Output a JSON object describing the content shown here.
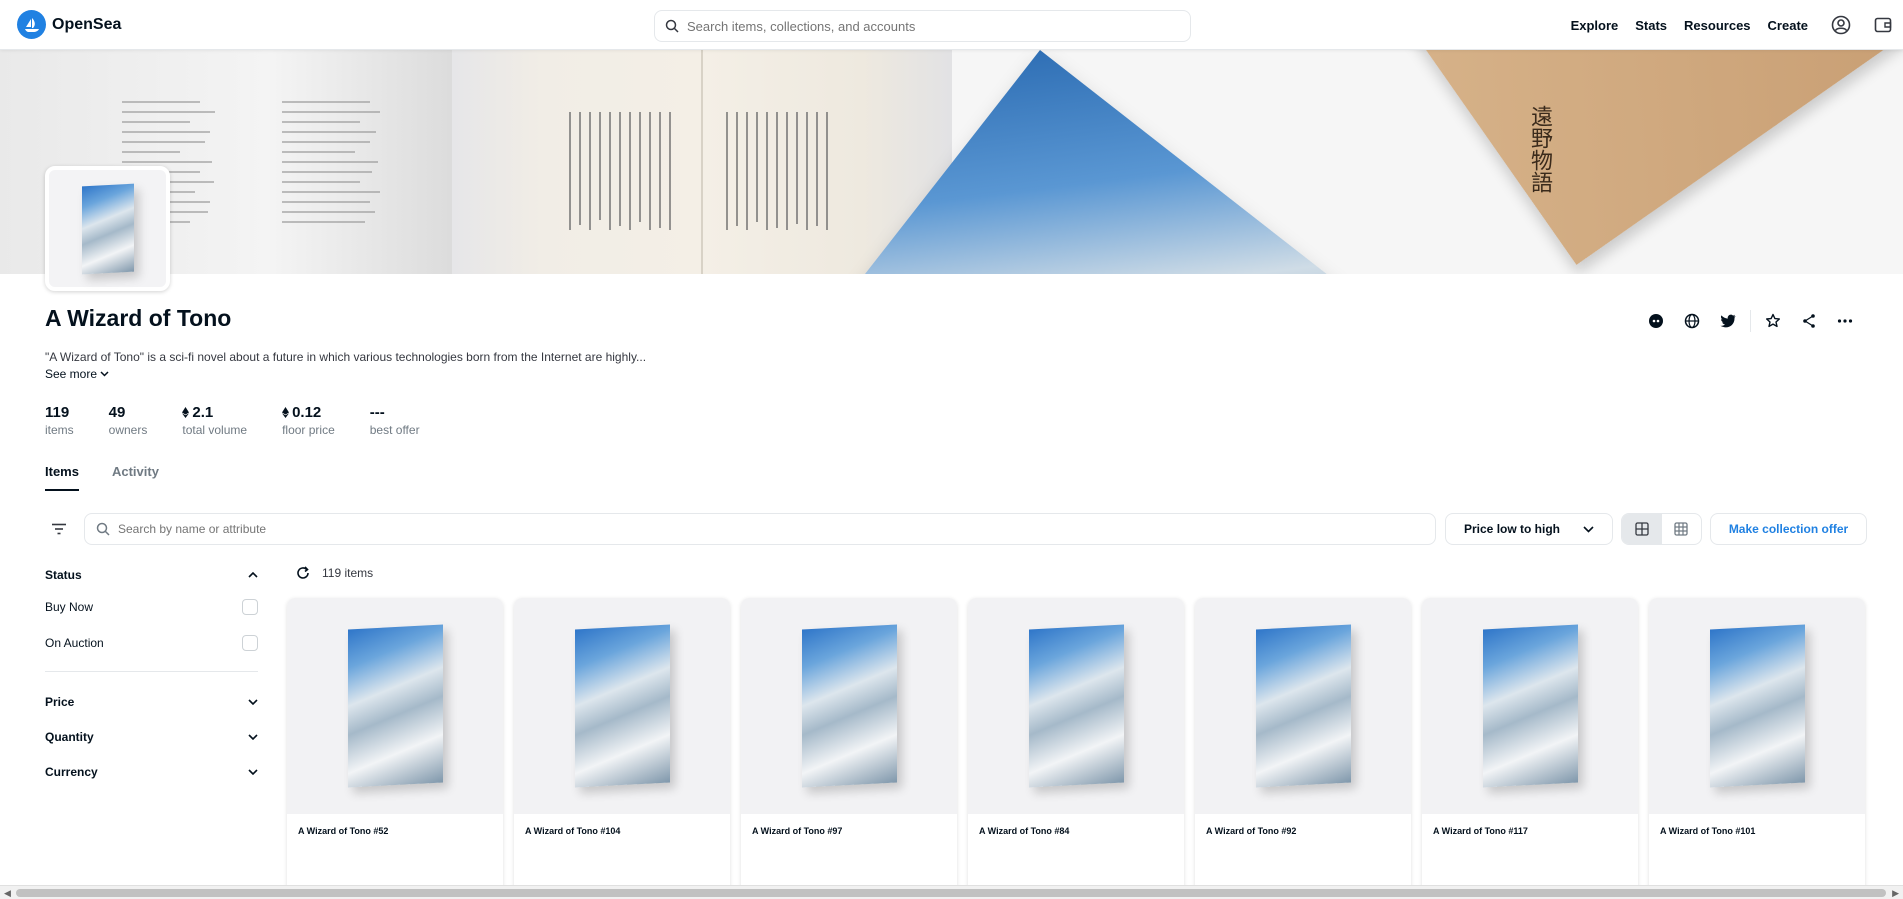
{
  "nav": {
    "brand": "OpenSea",
    "search_placeholder": "Search items, collections, and accounts",
    "links": [
      "Explore",
      "Stats",
      "Resources",
      "Create"
    ],
    "icons": [
      "account-icon",
      "wallet-icon"
    ]
  },
  "banner": {
    "kanji": "遠野物語"
  },
  "collection": {
    "title": "A Wizard of Tono",
    "description": "\"A Wizard of Tono\" is a sci-fi novel about a future in which various technologies born from the Internet are highly...",
    "see_more": "See more",
    "stats": [
      {
        "value": "119",
        "label": "items",
        "eth": false
      },
      {
        "value": "49",
        "label": "owners",
        "eth": false
      },
      {
        "value": "2.1",
        "label": "total volume",
        "eth": true
      },
      {
        "value": "0.12",
        "label": "floor price",
        "eth": true
      },
      {
        "value": "---",
        "label": "best offer",
        "eth": false
      }
    ],
    "action_icons": [
      "discord-icon",
      "globe-icon",
      "twitter-icon",
      "star-icon",
      "share-icon",
      "more-icon"
    ]
  },
  "tabs": [
    {
      "label": "Items",
      "active": true
    },
    {
      "label": "Activity",
      "active": false
    }
  ],
  "toolbar": {
    "search_placeholder": "Search by name or attribute",
    "sort_label": "Price low to high",
    "offer_label": "Make collection offer"
  },
  "filters": {
    "status_title": "Status",
    "status_options": [
      "Buy Now",
      "On Auction"
    ],
    "sections": [
      "Price",
      "Quantity",
      "Currency"
    ]
  },
  "items": {
    "count_label": "119 items",
    "cards": [
      "A Wizard of Tono #52",
      "A Wizard of Tono #104",
      "A Wizard of Tono #97",
      "A Wizard of Tono #84",
      "A Wizard of Tono #92",
      "A Wizard of Tono #117",
      "A Wizard of Tono #101"
    ]
  },
  "colors": {
    "accent": "#2081e2",
    "text": "#04111d",
    "muted": "#707a83",
    "border": "#e5e8eb"
  }
}
